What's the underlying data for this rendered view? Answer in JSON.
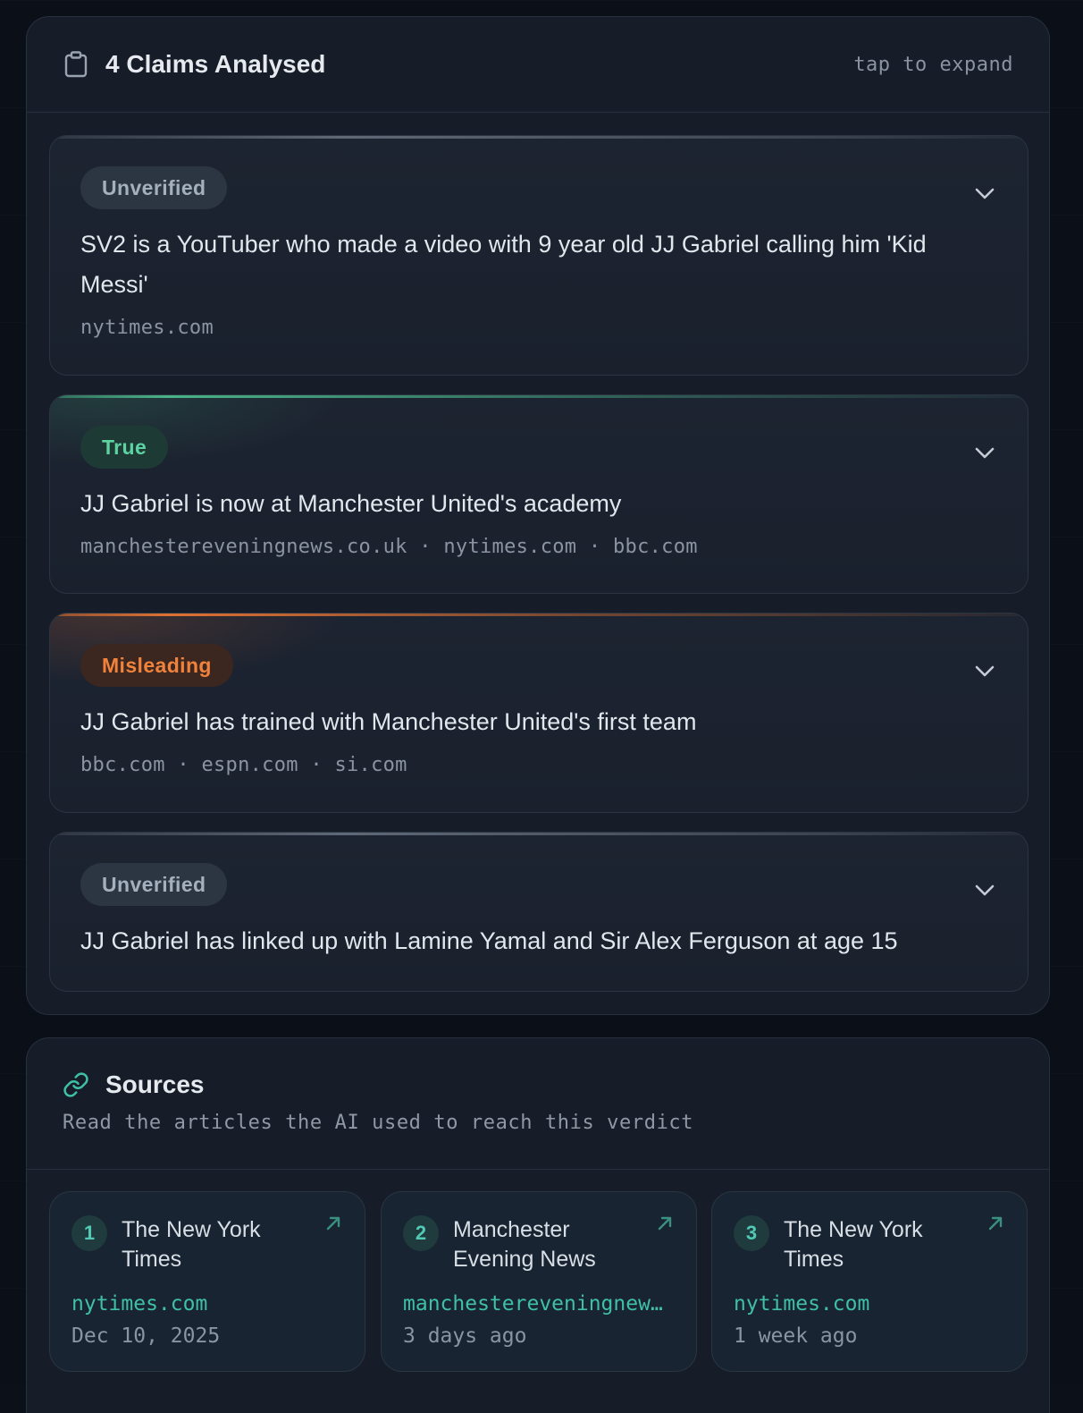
{
  "claims_panel": {
    "title": "4 Claims Analysed",
    "hint": "tap to expand",
    "header_icon": "clipboard-icon",
    "claims": [
      {
        "verdict": "Unverified",
        "verdict_color": "#a5b0bf",
        "text": "SV2 is a YouTuber who made a video with 9 year old JJ Gabriel calling him 'Kid Messi'",
        "sources": "nytimes.com"
      },
      {
        "verdict": "True",
        "verdict_color": "#5ed3a2",
        "text": "JJ Gabriel is now at Manchester United's academy",
        "sources": "manchestereveningnews.co.uk · nytimes.com · bbc.com"
      },
      {
        "verdict": "Misleading",
        "verdict_color": "#f0823c",
        "text": "JJ Gabriel has trained with Manchester United's first team",
        "sources": "bbc.com · espn.com · si.com"
      },
      {
        "verdict": "Unverified",
        "verdict_color": "#a5b0bf",
        "text": "JJ Gabriel has linked up with Lamine Yamal and Sir Alex Ferguson at age 15",
        "sources": ""
      }
    ]
  },
  "sources_panel": {
    "title": "Sources",
    "subtitle": "Read the articles the AI used to reach this verdict",
    "header_icon": "link-icon",
    "items": [
      {
        "num": "1",
        "name": "The New York Times",
        "domain": "nytimes.com",
        "date": "Dec 10, 2025"
      },
      {
        "num": "2",
        "name": "Manchester Evening News",
        "domain": "manchestereveningnews.co.uk",
        "date": "3 days ago"
      },
      {
        "num": "3",
        "name": "The New York Times",
        "domain": "nytimes.com",
        "date": "1 week ago"
      }
    ]
  },
  "colors": {
    "accent_teal": "#3fc0a6",
    "true_green": "#5ed3a2",
    "misleading_orange": "#f0823c",
    "unverified_gray": "#a5b0bf"
  }
}
